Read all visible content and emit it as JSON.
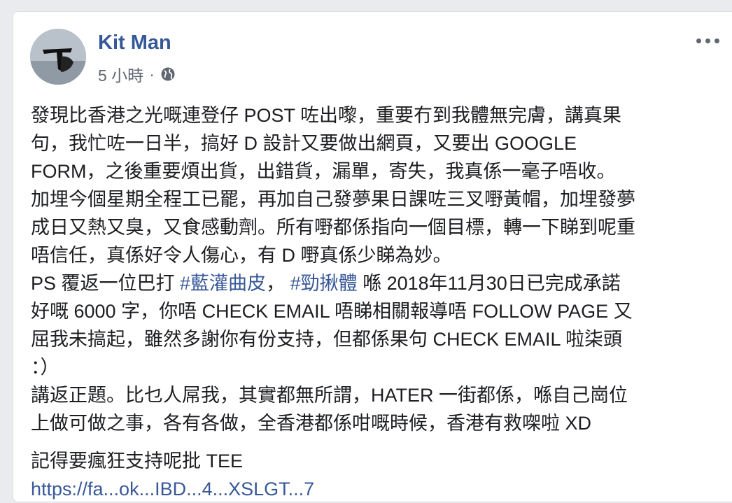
{
  "post": {
    "author": "Kit Man",
    "time": "5 小時",
    "dot": "·",
    "text_lines": [
      "發現比香港之光嘅連登仔 POST 咗出嚟，重要冇到我體無完膚，講真果",
      "句，我忙咗一日半，搞好 D 設計又要做出網頁，又要出 GOOGLE",
      "FORM，之後重要煩出貨，出錯貨，漏單，寄失，我真係一毫子唔收。",
      "加埋今個星期全程工已罷，再加自己發夢果日課咗三叉嘢黃帽，加埋發夢",
      "成日又熱又臭，又食感動劑。所有嘢都係指向一個目標，轉一下睇到呢重",
      "唔信任，真係好令人傷心，有 D 嘢真係少睇為妙。"
    ],
    "ps_line": {
      "prefix": "PS 覆返一位巴打 ",
      "tag1": "#藍灌曲皮",
      "sep": "， ",
      "tag2": "#勁揪體",
      "suffix": " 喺 2018年11月30日已完成承諾"
    },
    "text_lines_2": [
      "好嘅 6000 字，你唔 CHECK EMAIL 唔睇相關報導唔 FOLLOW PAGE 又",
      "屈我未搞起，雖然多謝你有份支持，但都係果句 CHECK EMAIL 啦柒頭",
      "：）",
      "講返正題。比乜人屌我，其實都無所謂，HATER 一街都係，喺自己崗位",
      "上做可做之事，各有各做，全香港都係咁嘅時候，香港有救㗎啦 XD"
    ],
    "last_line": "記得要瘋狂支持呢批 TEE",
    "url_partial": "https://fa...ok...IBD...4...XSLGT...7"
  },
  "colors": {
    "link": "#385898",
    "author": "#365899",
    "meta": "#606770",
    "text": "#1c1e21",
    "background": "#e9ebee",
    "card": "#ffffff"
  },
  "icons": {
    "privacy": "globe-icon",
    "options": "more-options-icon"
  }
}
